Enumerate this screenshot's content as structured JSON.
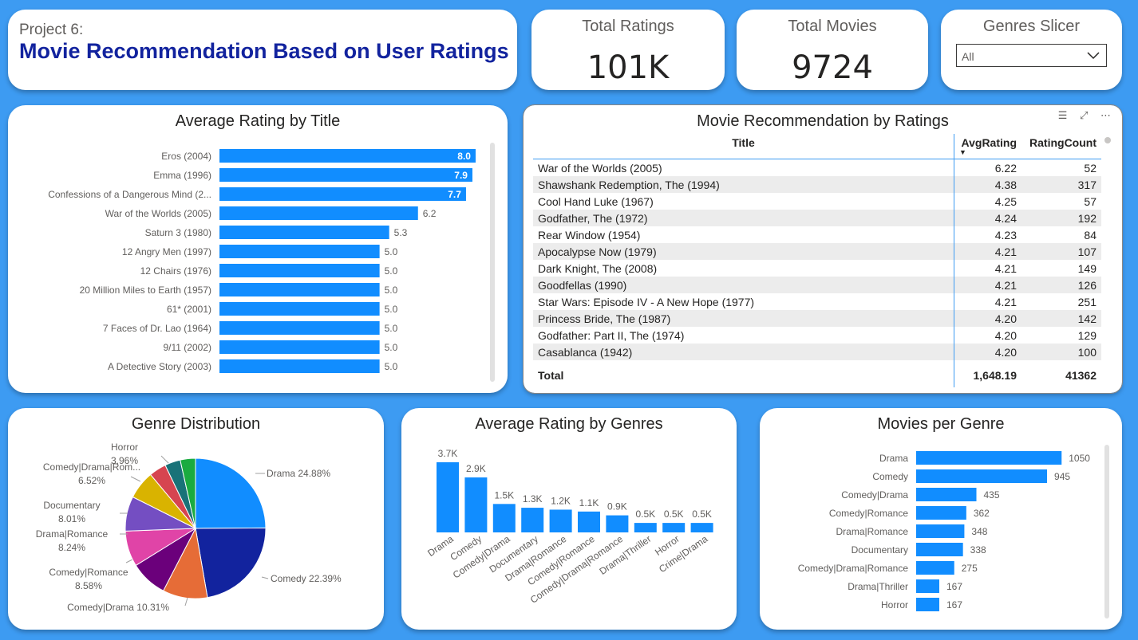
{
  "header": {
    "subtitle": "Project 6:",
    "title": "Movie Recommendation Based on User Ratings"
  },
  "kpis": [
    {
      "label": "Total Ratings",
      "value": "101K"
    },
    {
      "label": "Total Movies",
      "value": "9724"
    }
  ],
  "slicer": {
    "label": "Genres Slicer",
    "value": "All"
  },
  "colors": {
    "background": "#3d9bf2",
    "bar": "#118dff",
    "title": "#12239e"
  },
  "chart_data": [
    {
      "type": "bar",
      "orientation": "horizontal",
      "title": "Average Rating by Title",
      "categories": [
        "Eros (2004)",
        "Emma (1996)",
        "Confessions of a Dangerous Mind (2...",
        "War of the Worlds (2005)",
        "Saturn 3 (1980)",
        "12 Angry Men (1997)",
        "12 Chairs (1976)",
        "20 Million Miles to Earth (1957)",
        "61* (2001)",
        "7 Faces of Dr. Lao (1964)",
        "9/11 (2002)",
        "A Detective Story (2003)"
      ],
      "values": [
        8.0,
        7.9,
        7.7,
        6.2,
        5.3,
        5.0,
        5.0,
        5.0,
        5.0,
        5.0,
        5.0,
        5.0
      ],
      "labels": [
        "8.0",
        "7.9",
        "7.7",
        "6.2",
        "5.3",
        "5.0",
        "5.0",
        "5.0",
        "5.0",
        "5.0",
        "5.0",
        "5.0"
      ],
      "xlim": [
        0,
        8.1
      ]
    },
    {
      "type": "table",
      "title": "Movie Recommendation by Ratings",
      "columns": [
        "Title",
        "AvgRating",
        "RatingCount"
      ],
      "rows": [
        [
          "War of the Worlds (2005)",
          "6.22",
          "52"
        ],
        [
          "Shawshank Redemption, The (1994)",
          "4.38",
          "317"
        ],
        [
          "Cool Hand Luke (1967)",
          "4.25",
          "57"
        ],
        [
          "Godfather, The (1972)",
          "4.24",
          "192"
        ],
        [
          "Rear Window (1954)",
          "4.23",
          "84"
        ],
        [
          "Apocalypse Now (1979)",
          "4.21",
          "107"
        ],
        [
          "Dark Knight, The (2008)",
          "4.21",
          "149"
        ],
        [
          "Goodfellas (1990)",
          "4.21",
          "126"
        ],
        [
          "Star Wars: Episode IV - A New Hope (1977)",
          "4.21",
          "251"
        ],
        [
          "Princess Bride, The (1987)",
          "4.20",
          "142"
        ],
        [
          "Godfather: Part II, The (1974)",
          "4.20",
          "129"
        ],
        [
          "Casablanca (1942)",
          "4.20",
          "100"
        ]
      ],
      "total": [
        "Total",
        "1,648.19",
        "41362"
      ]
    },
    {
      "type": "pie",
      "title": "Genre Distribution",
      "slices": [
        {
          "label": "Drama",
          "percent": "24.88%",
          "value": 24.88,
          "color": "#118dff"
        },
        {
          "label": "Comedy",
          "percent": "22.39%",
          "value": 22.39,
          "color": "#12239e"
        },
        {
          "label": "Comedy|Drama",
          "percent": "10.31%",
          "value": 10.31,
          "color": "#e66c37"
        },
        {
          "label": "Comedy|Romance",
          "percent": "8.58%",
          "value": 8.58,
          "color": "#6b007b"
        },
        {
          "label": "Drama|Romance",
          "percent": "8.24%",
          "value": 8.24,
          "color": "#e044a7"
        },
        {
          "label": "Documentary",
          "percent": "8.01%",
          "value": 8.01,
          "color": "#744ec2"
        },
        {
          "label": "Comedy|Drama|Rom...",
          "percent": "6.52%",
          "value": 6.52,
          "color": "#d9b300"
        },
        {
          "label": "Horror",
          "percent": "3.96%",
          "value": 3.96,
          "color": "#d64550"
        },
        {
          "label": "",
          "percent": "",
          "value": 3.6,
          "color": "#197278"
        },
        {
          "label": "",
          "percent": "",
          "value": 3.51,
          "color": "#1aab40"
        }
      ]
    },
    {
      "type": "bar",
      "orientation": "vertical",
      "title": "Average Rating by Genres",
      "categories": [
        "Drama",
        "Comedy",
        "Comedy|Drama",
        "Documentary",
        "Drama|Romance",
        "Comedy|Romance",
        "Comedy|Drama|Romance",
        "Drama|Thriller",
        "Horror",
        "Crime|Drama"
      ],
      "values": [
        3700,
        2900,
        1500,
        1300,
        1200,
        1100,
        900,
        500,
        500,
        500
      ],
      "labels": [
        "3.7K",
        "2.9K",
        "1.5K",
        "1.3K",
        "1.2K",
        "1.1K",
        "0.9K",
        "0.5K",
        "0.5K",
        "0.5K"
      ],
      "ylim": [
        0,
        3700
      ]
    },
    {
      "type": "bar",
      "orientation": "horizontal",
      "title": "Movies per Genre",
      "categories": [
        "Drama",
        "Comedy",
        "Comedy|Drama",
        "Comedy|Romance",
        "Drama|Romance",
        "Documentary",
        "Comedy|Drama|Romance",
        "Drama|Thriller",
        "Horror"
      ],
      "values": [
        1050,
        945,
        435,
        362,
        348,
        338,
        275,
        167,
        167
      ],
      "labels": [
        "1050",
        "945",
        "435",
        "362",
        "348",
        "338",
        "275",
        "167",
        "167"
      ],
      "xlim": [
        0,
        1060
      ]
    }
  ]
}
